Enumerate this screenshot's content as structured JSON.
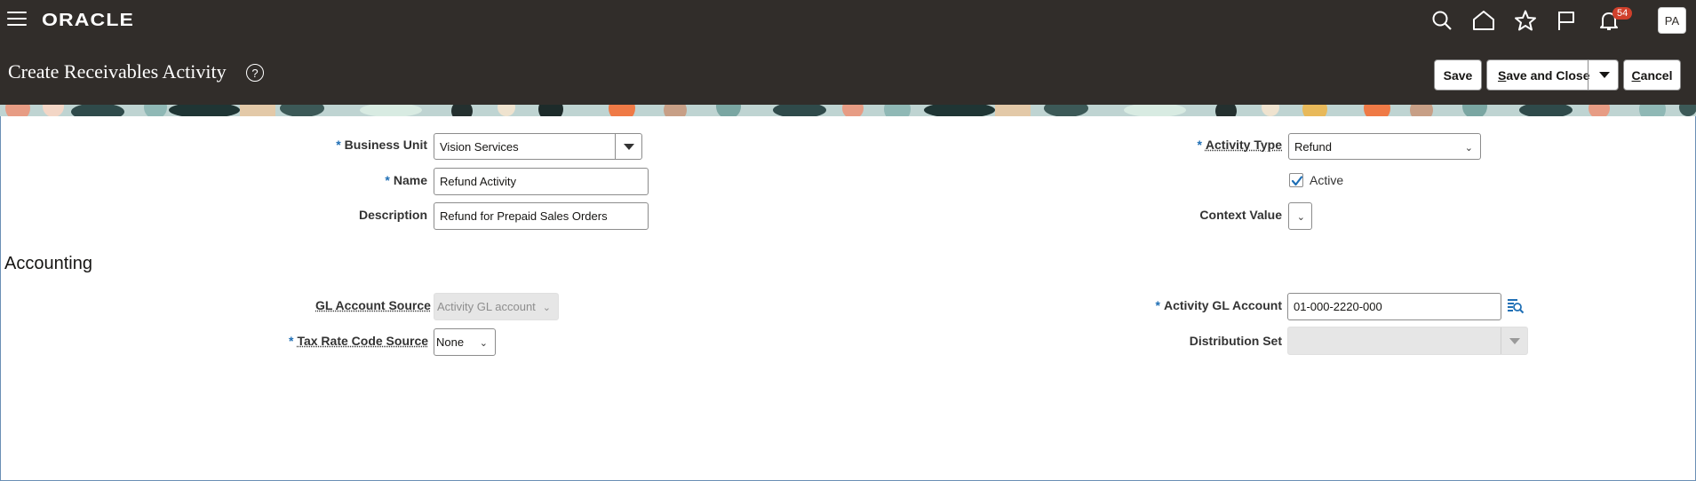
{
  "header": {
    "brand": "ORACLE",
    "notifications_count": "54",
    "avatar_initials": "PA",
    "icons": [
      "menu-icon",
      "search-icon",
      "home-icon",
      "star-icon",
      "flag-icon",
      "bell-icon"
    ]
  },
  "page": {
    "title": "Create Receivables Activity",
    "buttons": {
      "save": "Save",
      "save_and_close": "ave and Close",
      "save_and_close_key": "S",
      "cancel": "ancel",
      "cancel_key": "C"
    }
  },
  "form": {
    "business_unit": {
      "label": "Business Unit",
      "value": "Vision Services",
      "required": true
    },
    "name": {
      "label": "Name",
      "value": "Refund Activity",
      "required": true
    },
    "description": {
      "label": "Description",
      "value": "Refund for Prepaid Sales Orders"
    },
    "activity_type": {
      "label": "Activity Type",
      "value": "Refund",
      "required": true
    },
    "active": {
      "label": "Active",
      "checked": true
    },
    "context_value": {
      "label": "Context Value",
      "value": ""
    }
  },
  "accounting": {
    "title": "Accounting",
    "gl_account_source": {
      "label": "GL Account Source",
      "value": "Activity GL account",
      "disabled": true
    },
    "tax_rate_code_source": {
      "label": "Tax Rate Code Source",
      "value": "None",
      "required": true
    },
    "activity_gl_account": {
      "label": "Activity GL Account",
      "value": "01-000-2220-000",
      "required": true
    },
    "distribution_set": {
      "label": "Distribution Set",
      "value": "",
      "disabled": true
    }
  },
  "colors": {
    "header_bg": "#312d2a",
    "required_marker": "#1f6fb5",
    "badge": "#d0402b"
  }
}
